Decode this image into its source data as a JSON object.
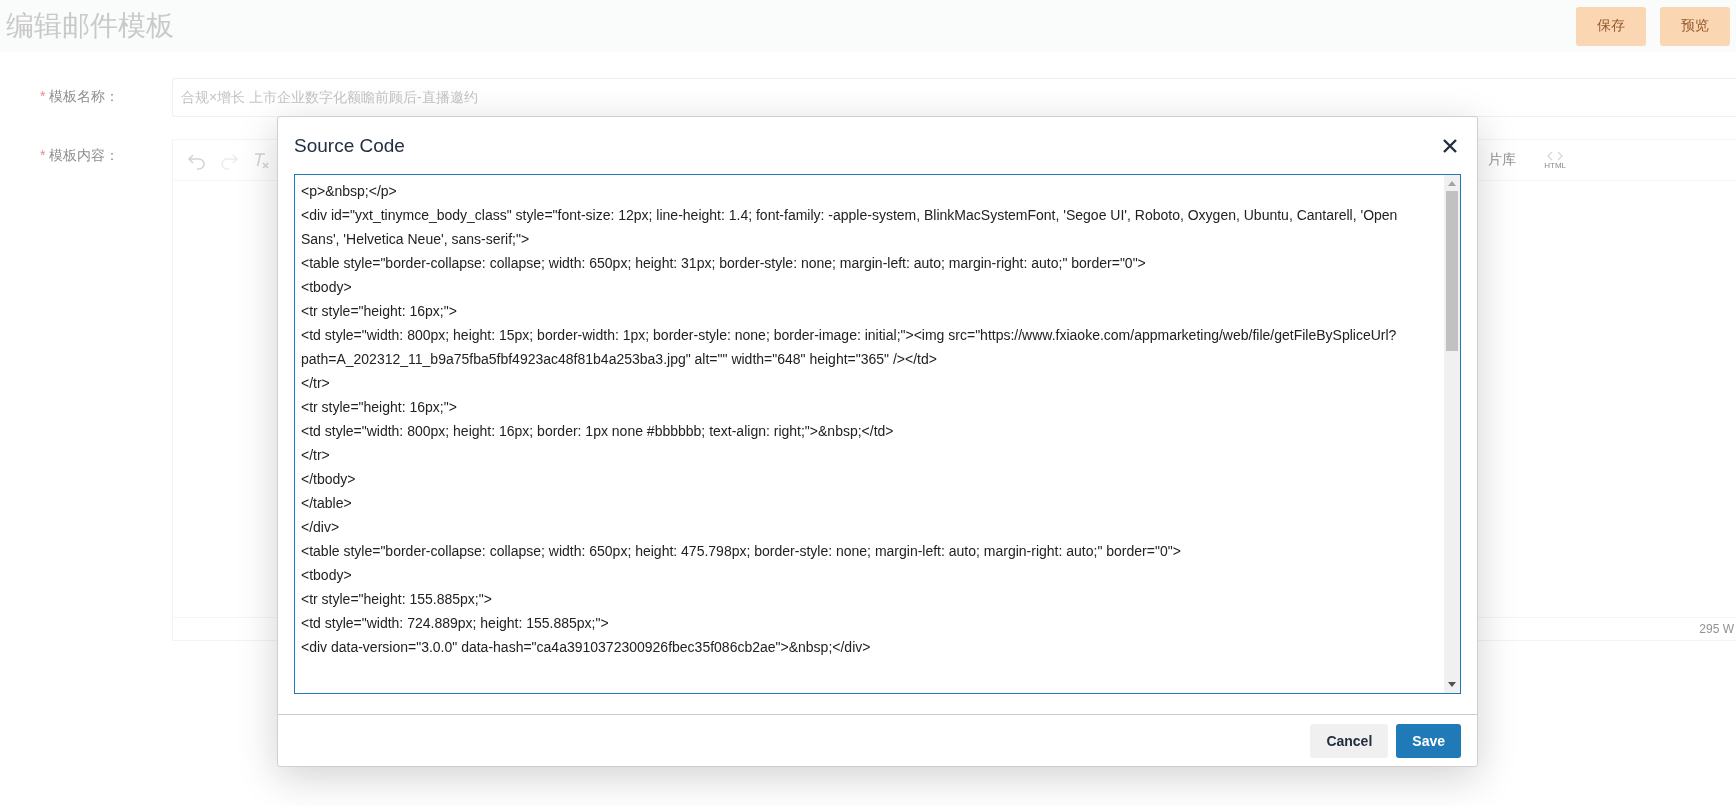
{
  "page": {
    "title": "编辑邮件模板",
    "buttons": [
      {
        "label": "保存"
      },
      {
        "label": "预览"
      }
    ]
  },
  "form": {
    "name_field": {
      "required_mark": "*",
      "label": "模板名称：",
      "value": "合规×增长 上市企业数字化额瞻前顾后-直播邀约"
    },
    "content_field": {
      "required_mark": "*",
      "label": "模板内容：",
      "toolbar_partial_label": "片库",
      "html_button_label": "HTML",
      "word_count": "295 W"
    }
  },
  "dialog": {
    "title": "Source Code",
    "code_lines": [
      "<p>&nbsp;</p>",
      "<div id=\"yxt_tinymce_body_class\" style=\"font-size: 12px; line-height: 1.4; font-family: -apple-system, BlinkMacSystemFont, 'Segoe UI', Roboto, Oxygen, Ubuntu, Cantarell, 'Open Sans', 'Helvetica Neue', sans-serif;\">",
      "<table style=\"border-collapse: collapse; width: 650px; height: 31px; border-style: none; margin-left: auto; margin-right: auto;\" border=\"0\">",
      "<tbody>",
      "<tr style=\"height: 16px;\">",
      "<td style=\"width: 800px; height: 15px; border-width: 1px; border-style: none; border-image: initial;\"><img src=\"https://www.fxiaoke.com/appmarketing/web/file/getFileBySpliceUrl?path=A_202312_11_b9a75fba5fbf4923ac48f81b4a253ba3.jpg\" alt=\"\" width=\"648\" height=\"365\" /></td>",
      "</tr>",
      "<tr style=\"height: 16px;\">",
      "<td style=\"width: 800px; height: 16px; border: 1px none #bbbbbb; text-align: right;\">&nbsp;</td>",
      "</tr>",
      "</tbody>",
      "</table>",
      "</div>",
      "<table style=\"border-collapse: collapse; width: 650px; height: 475.798px; border-style: none; margin-left: auto; margin-right: auto;\" border=\"0\">",
      "<tbody>",
      "<tr style=\"height: 155.885px;\">",
      "<td style=\"width: 724.889px; height: 155.885px;\">",
      "<div data-version=\"3.0.0\" data-hash=\"ca4a3910372300926fbec35f086cb2ae\">&nbsp;</div>"
    ],
    "buttons": [
      {
        "label": "Cancel",
        "kind": "secondary"
      },
      {
        "label": "Save",
        "kind": "primary"
      }
    ]
  }
}
